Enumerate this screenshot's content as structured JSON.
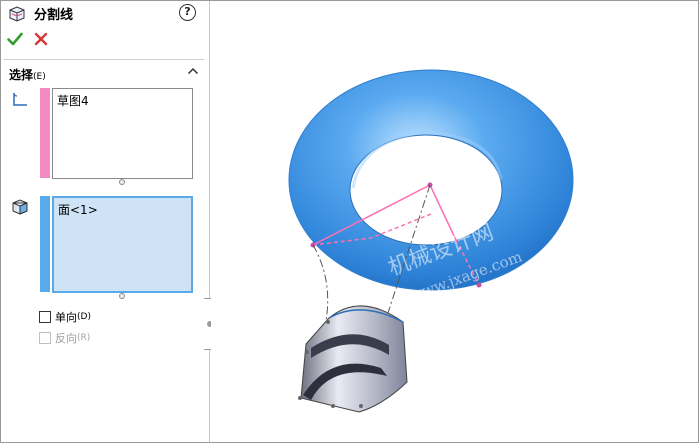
{
  "panel": {
    "title": "分割线",
    "help_label": "?",
    "icons": {
      "feature": "split-line-icon",
      "ok": "checkmark-icon",
      "cancel": "x-icon",
      "help": "help-icon"
    },
    "colors": {
      "ok": "#2e9e2e",
      "cancel": "#d93636",
      "accent": "#5aa9e8"
    },
    "selection_group": {
      "title": "选择",
      "accelerator": "(E)",
      "sketch_box": {
        "value": "草图4",
        "strip_color": "#f48ac3",
        "icon": "sketch-icon"
      },
      "face_box": {
        "value": "面<1>",
        "strip_color": "#5aa9e8",
        "icon": "face-icon"
      },
      "single_direction": {
        "label": "单向",
        "accelerator": "(D)",
        "checked": false,
        "enabled": true
      },
      "reverse": {
        "label": "反向",
        "accelerator": "(R)",
        "checked": false,
        "enabled": false
      }
    }
  },
  "viewport": {
    "watermark_cn": "机械设计网",
    "watermark_url": "www.jxage.com",
    "model_colors": {
      "torus": "#3b92e6",
      "sketch_line": "#ff6fb4",
      "cylinder": "#b9bcc8"
    }
  }
}
